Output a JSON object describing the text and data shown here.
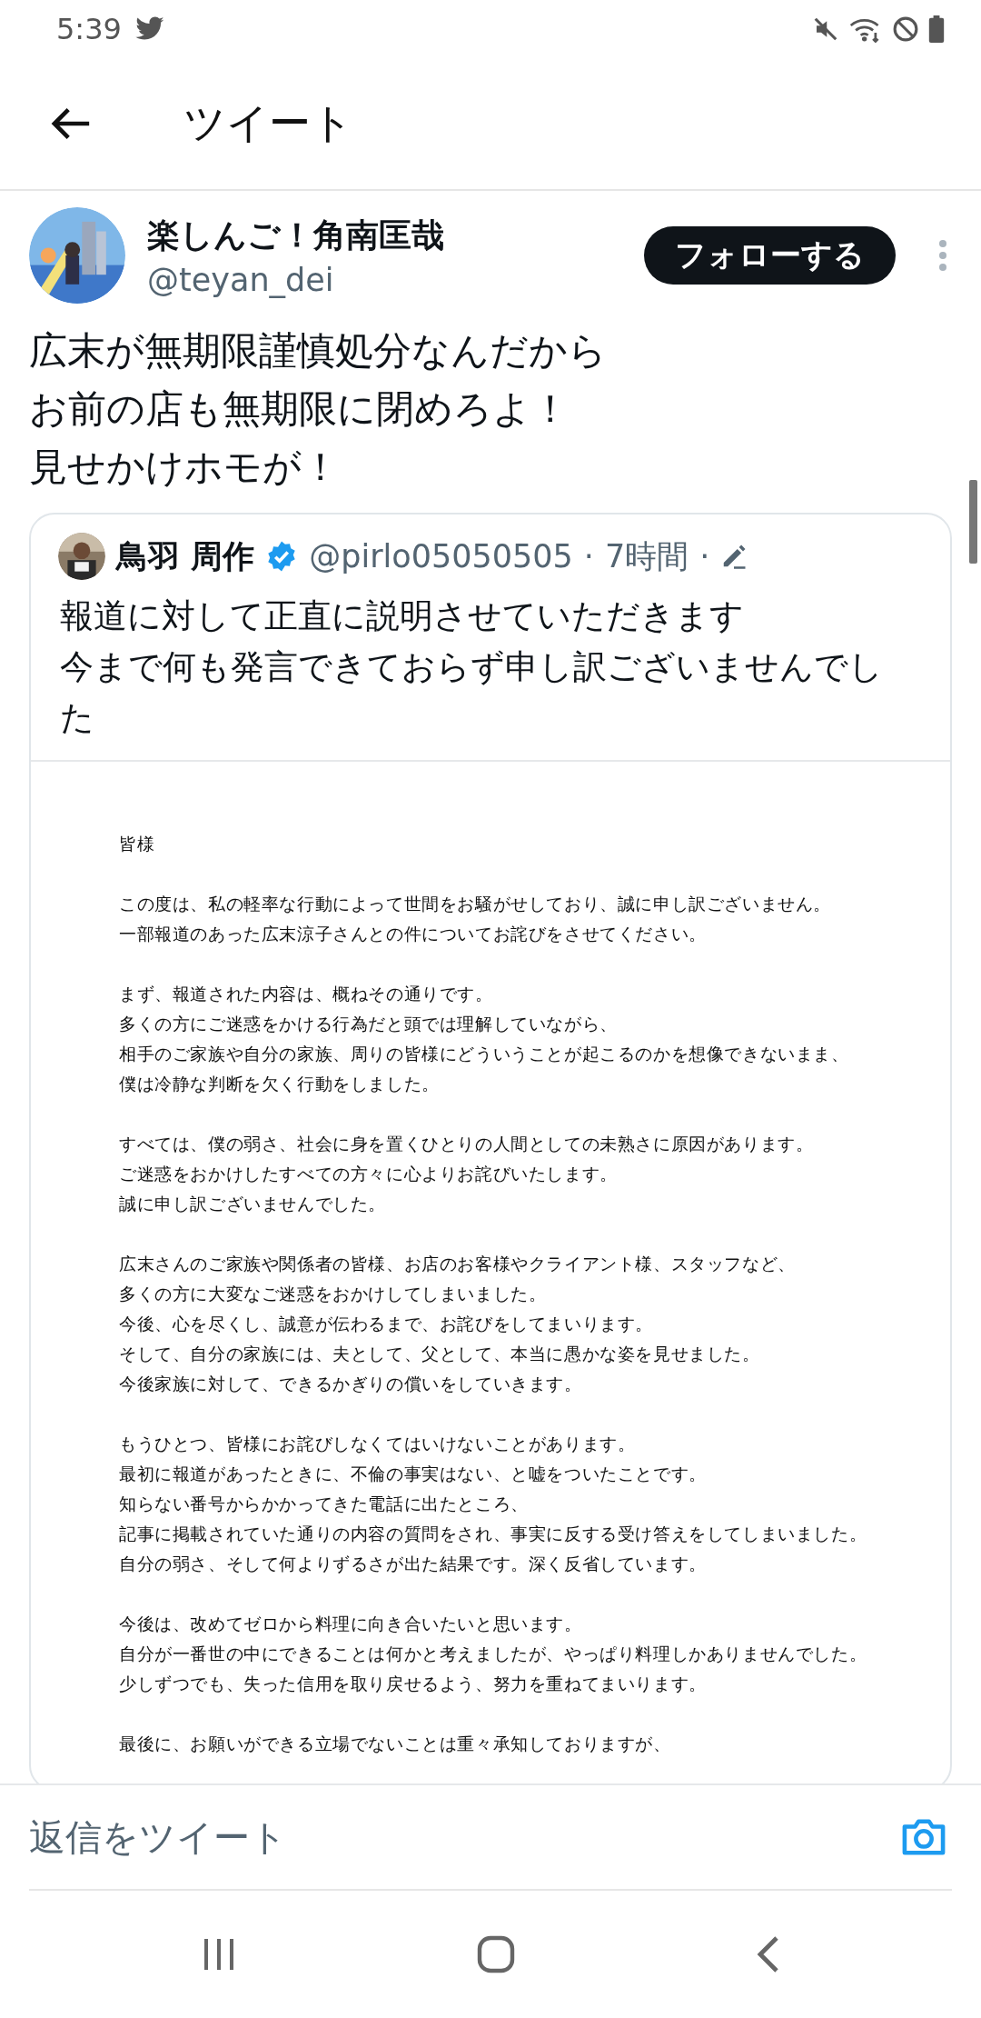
{
  "status_bar": {
    "time": "5:39"
  },
  "header": {
    "title": "ツイート"
  },
  "tweet": {
    "author": {
      "name": "楽しんご！角南匡哉",
      "handle": "@teyan_dei"
    },
    "follow_button": "フォローする",
    "text": [
      "広末が無期限謹慎処分なんだから",
      "お前の店も無期限に閉めろよ！",
      "見せかけホモが！"
    ],
    "quoted_tweet": {
      "author": {
        "name": "鳥羽 周作",
        "handle": "@pirlo05050505",
        "verified": true
      },
      "time": "7時間",
      "separators": [
        "·",
        "·"
      ],
      "text": [
        "報道に対して正直に説明させていただきます",
        "今まで何も発言できておらず申し訳ございませんでした"
      ],
      "document": {
        "paragraphs": [
          [
            "皆様"
          ],
          [
            "この度は、私の軽率な行動によって世間をお騒がせしており、誠に申し訳ございません。",
            "一部報道のあった広末涼子さんとの件についてお詫びをさせてください。"
          ],
          [
            "まず、報道された内容は、概ねその通りです。",
            "多くの方にご迷惑をかける行為だと頭では理解していながら、",
            "相手のご家族や自分の家族、周りの皆様にどういうことが起こるのかを想像できないまま、",
            "僕は冷静な判断を欠く行動をしました。"
          ],
          [
            "すべては、僕の弱さ、社会に身を置くひとりの人間としての未熟さに原因があります。",
            "ご迷惑をおかけしたすべての方々に心よりお詫びいたします。",
            "誠に申し訳ございませんでした。"
          ],
          [
            "広末さんのご家族や関係者の皆様、お店のお客様やクライアント様、スタッフなど、",
            "多くの方に大変なご迷惑をおかけしてしまいました。",
            "今後、心を尽くし、誠意が伝わるまで、お詫びをしてまいります。",
            "そして、自分の家族には、夫として、父として、本当に愚かな姿を見せました。",
            "今後家族に対して、できるかぎりの償いをしていきます。"
          ],
          [
            "もうひとつ、皆様にお詫びしなくてはいけないことがあります。",
            "最初に報道があったときに、不倫の事実はない、と嘘をついたことです。",
            "知らない番号からかかってきた電話に出たところ、",
            "記事に掲載されていた通りの内容の質問をされ、事実に反する受け答えをしてしまいました。",
            "自分の弱さ、そして何よりずるさが出た結果です。深く反省しています。"
          ],
          [
            "今後は、改めてゼロから料理に向き合いたいと思います。",
            "自分が一番世の中にできることは何かと考えましたが、やっぱり料理しかありませんでした。",
            "少しずつでも、失った信用を取り戻せるよう、努力を重ねてまいります。"
          ],
          [
            "最後に、お願いができる立場でないことは重々承知しておりますが、"
          ]
        ]
      }
    }
  },
  "reply_bar": {
    "placeholder": "返信をツイート"
  }
}
